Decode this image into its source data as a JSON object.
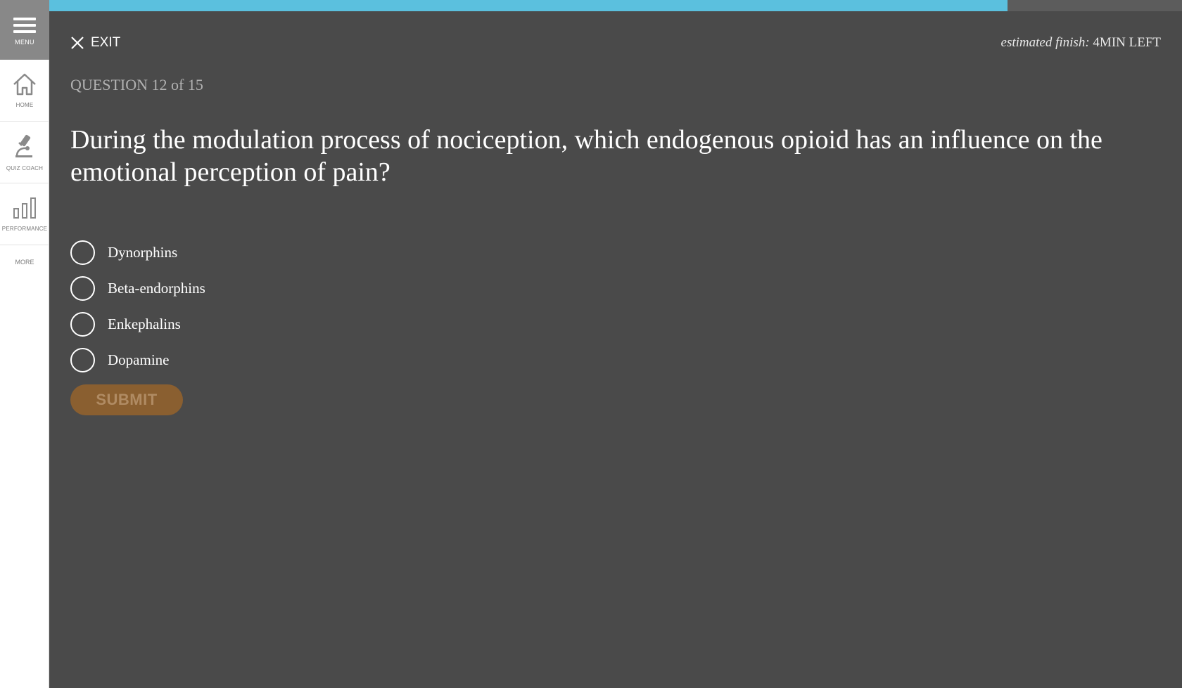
{
  "sidebar": {
    "menu": {
      "label": "MENU",
      "icon": "hamburger-icon"
    },
    "items": [
      {
        "label": "HOME",
        "icon": "home-icon"
      },
      {
        "label": "QUIZ COACH",
        "icon": "microscope-icon"
      },
      {
        "label": "PERFORMANCE",
        "icon": "bar-chart-icon"
      }
    ],
    "more_label": "MORE"
  },
  "progress": {
    "fraction": 0.846,
    "fill_color": "#5bc0de",
    "track_color": "#5c5c5c"
  },
  "header": {
    "exit_label": "EXIT",
    "estimated_prefix": "estimated finish:",
    "estimated_value": "4MIN LEFT"
  },
  "quiz": {
    "question_number": "QUESTION 12 of 15",
    "question_text": "During the modulation process of nociception, which endogenous opioid has an influence on the emotional perception of pain?",
    "options": [
      {
        "label": "Dynorphins",
        "selected": false
      },
      {
        "label": "Beta-endorphins",
        "selected": false
      },
      {
        "label": "Enkephalins",
        "selected": false
      },
      {
        "label": "Dopamine",
        "selected": false
      }
    ],
    "submit_label": "SUBMIT",
    "submit_color": "#8a5f30"
  }
}
